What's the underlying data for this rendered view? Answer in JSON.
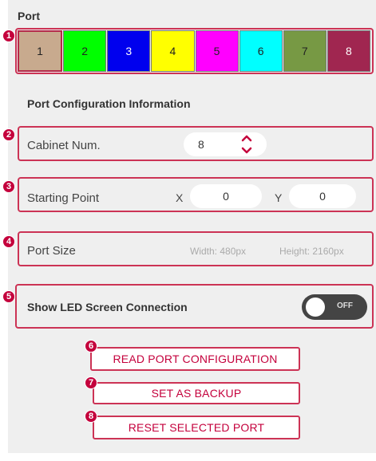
{
  "port_section": {
    "title": "Port",
    "ports": [
      {
        "label": "1",
        "color": "#c8aa8e",
        "text_color": "#222222",
        "selected": true
      },
      {
        "label": "2",
        "color": "#00ff00",
        "text_color": "#222222",
        "selected": false
      },
      {
        "label": "3",
        "color": "#0000ee",
        "text_color": "#ffffff",
        "selected": false
      },
      {
        "label": "4",
        "color": "#ffff00",
        "text_color": "#222222",
        "selected": false
      },
      {
        "label": "5",
        "color": "#ff00ff",
        "text_color": "#222222",
        "selected": false
      },
      {
        "label": "6",
        "color": "#00ffff",
        "text_color": "#222222",
        "selected": false
      },
      {
        "label": "7",
        "color": "#779944",
        "text_color": "#222222",
        "selected": false
      },
      {
        "label": "8",
        "color": "#a02650",
        "text_color": "#ffffff",
        "selected": false
      }
    ]
  },
  "config": {
    "title": "Port Configuration Information",
    "cabinet": {
      "label": "Cabinet Num.",
      "value": "8"
    },
    "starting_point": {
      "label": "Starting Point",
      "x_label": "X",
      "x_value": "0",
      "y_label": "Y",
      "y_value": "0"
    },
    "port_size": {
      "label": "Port Size",
      "width": "Width: 480px",
      "height": "Height: 2160px"
    }
  },
  "led": {
    "label": "Show LED Screen Connection",
    "toggle": "OFF"
  },
  "actions": {
    "read": "READ PORT CONFIGURATION",
    "backup": "SET AS BACKUP",
    "reset": "RESET SELECTED PORT"
  },
  "badges": [
    "1",
    "2",
    "3",
    "4",
    "5",
    "6",
    "7",
    "8"
  ],
  "accent_color": "#c4003c"
}
